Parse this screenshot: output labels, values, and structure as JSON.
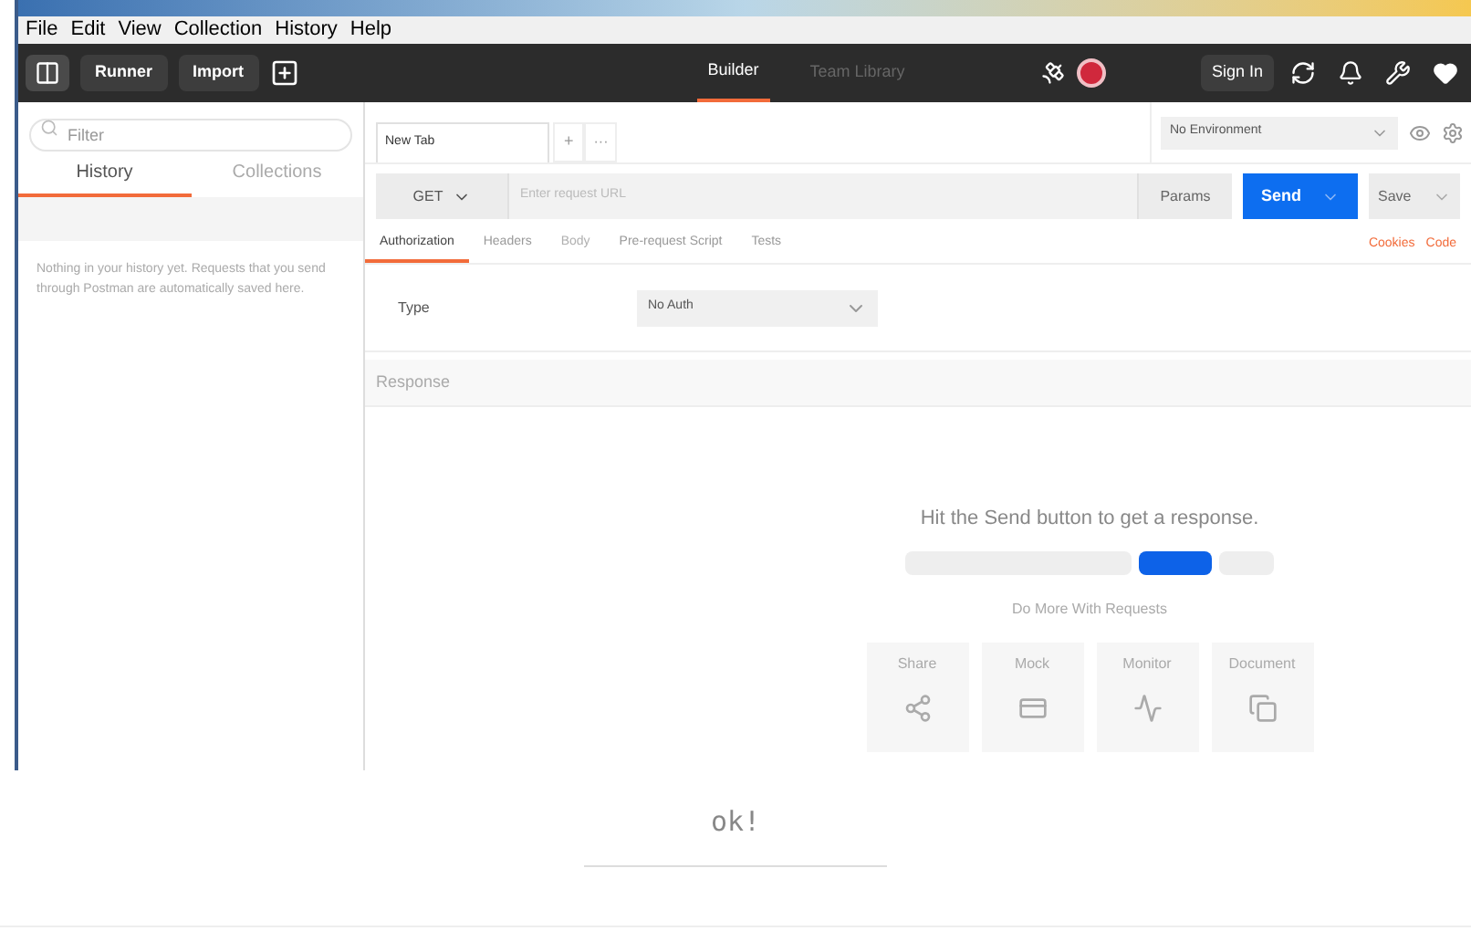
{
  "menu": [
    "File",
    "Edit",
    "View",
    "Collection",
    "History",
    "Help"
  ],
  "toolbar": {
    "buttons": [
      "Runner",
      "Import"
    ],
    "tabs": [
      {
        "label": "Builder",
        "selected": true
      },
      {
        "label": "Team Library",
        "selected": false
      }
    ],
    "sign_in": "Sign In"
  },
  "sidebar": {
    "filter_placeholder": "Filter",
    "tabs": [
      {
        "label": "History",
        "selected": true
      },
      {
        "label": "Collections",
        "selected": false
      }
    ],
    "empty_message": "Nothing in your history yet. Requests that you send through Postman are automatically saved here."
  },
  "request_tabs": [
    {
      "label": "New Tab",
      "selected": true
    }
  ],
  "add_tab": "+",
  "more_tabs": "···",
  "environment": "No Environment",
  "request": {
    "method": "GET",
    "url_placeholder": "Enter request URL",
    "params": "Params",
    "send": "Send",
    "save": "Save"
  },
  "subtabs": [
    {
      "label": "Authorization",
      "selected": true,
      "disabled": false
    },
    {
      "label": "Headers",
      "selected": false,
      "disabled": false
    },
    {
      "label": "Body",
      "selected": false,
      "disabled": true
    },
    {
      "label": "Pre-request Script",
      "selected": false,
      "disabled": false
    },
    {
      "label": "Tests",
      "selected": false,
      "disabled": false
    }
  ],
  "links": [
    "Cookies",
    "Code"
  ],
  "auth": {
    "type_label": "Type",
    "type_value": "No Auth"
  },
  "response": {
    "title": "Response",
    "hint": "Hit the Send button to get a response.",
    "more": "Do More With Requests",
    "cards": [
      {
        "label": "Share",
        "kind": "share"
      },
      {
        "label": "Mock",
        "kind": "mock"
      },
      {
        "label": "Monitor",
        "kind": "monitor"
      },
      {
        "label": "Document",
        "kind": "document"
      }
    ]
  },
  "caption": "ok!"
}
